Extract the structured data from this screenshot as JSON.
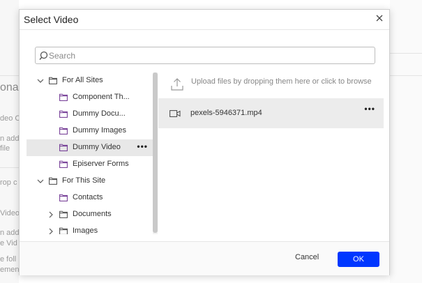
{
  "background": {
    "title_fragment": "onal",
    "fragments": [
      "deo C",
      "n add",
      "file",
      "rop c",
      "Video",
      "n add",
      "e Vid",
      "e foll",
      "emen"
    ]
  },
  "modal": {
    "title": "Select Video",
    "close_icon": "close-icon"
  },
  "search": {
    "placeholder": "Search",
    "value": ""
  },
  "tree": {
    "items": [
      {
        "label": "For All Sites",
        "expanded": true,
        "level": 0
      },
      {
        "label": "Component Th...",
        "level": 1
      },
      {
        "label": "Dummy Docu...",
        "level": 1
      },
      {
        "label": "Dummy Images",
        "level": 1
      },
      {
        "label": "Dummy Video",
        "level": 1,
        "selected": true,
        "more": "•••"
      },
      {
        "label": "Episerver Forms",
        "level": 1
      },
      {
        "label": "For This Site",
        "expanded": true,
        "level": 0
      },
      {
        "label": "Contacts",
        "level": 1
      },
      {
        "label": "Documents",
        "level": 1,
        "expanded": false
      },
      {
        "label": "Images",
        "level": 1,
        "expanded": false
      }
    ]
  },
  "upload": {
    "text": "Upload files by dropping them here or click to browse"
  },
  "files": [
    {
      "name": "pexels-5946371.mp4",
      "icon": "video-icon",
      "more": "•••"
    }
  ],
  "footer": {
    "cancel_label": "Cancel",
    "ok_label": "OK"
  },
  "colors": {
    "primary": "#0037ff",
    "selected_bg": "#e8e8e8"
  }
}
